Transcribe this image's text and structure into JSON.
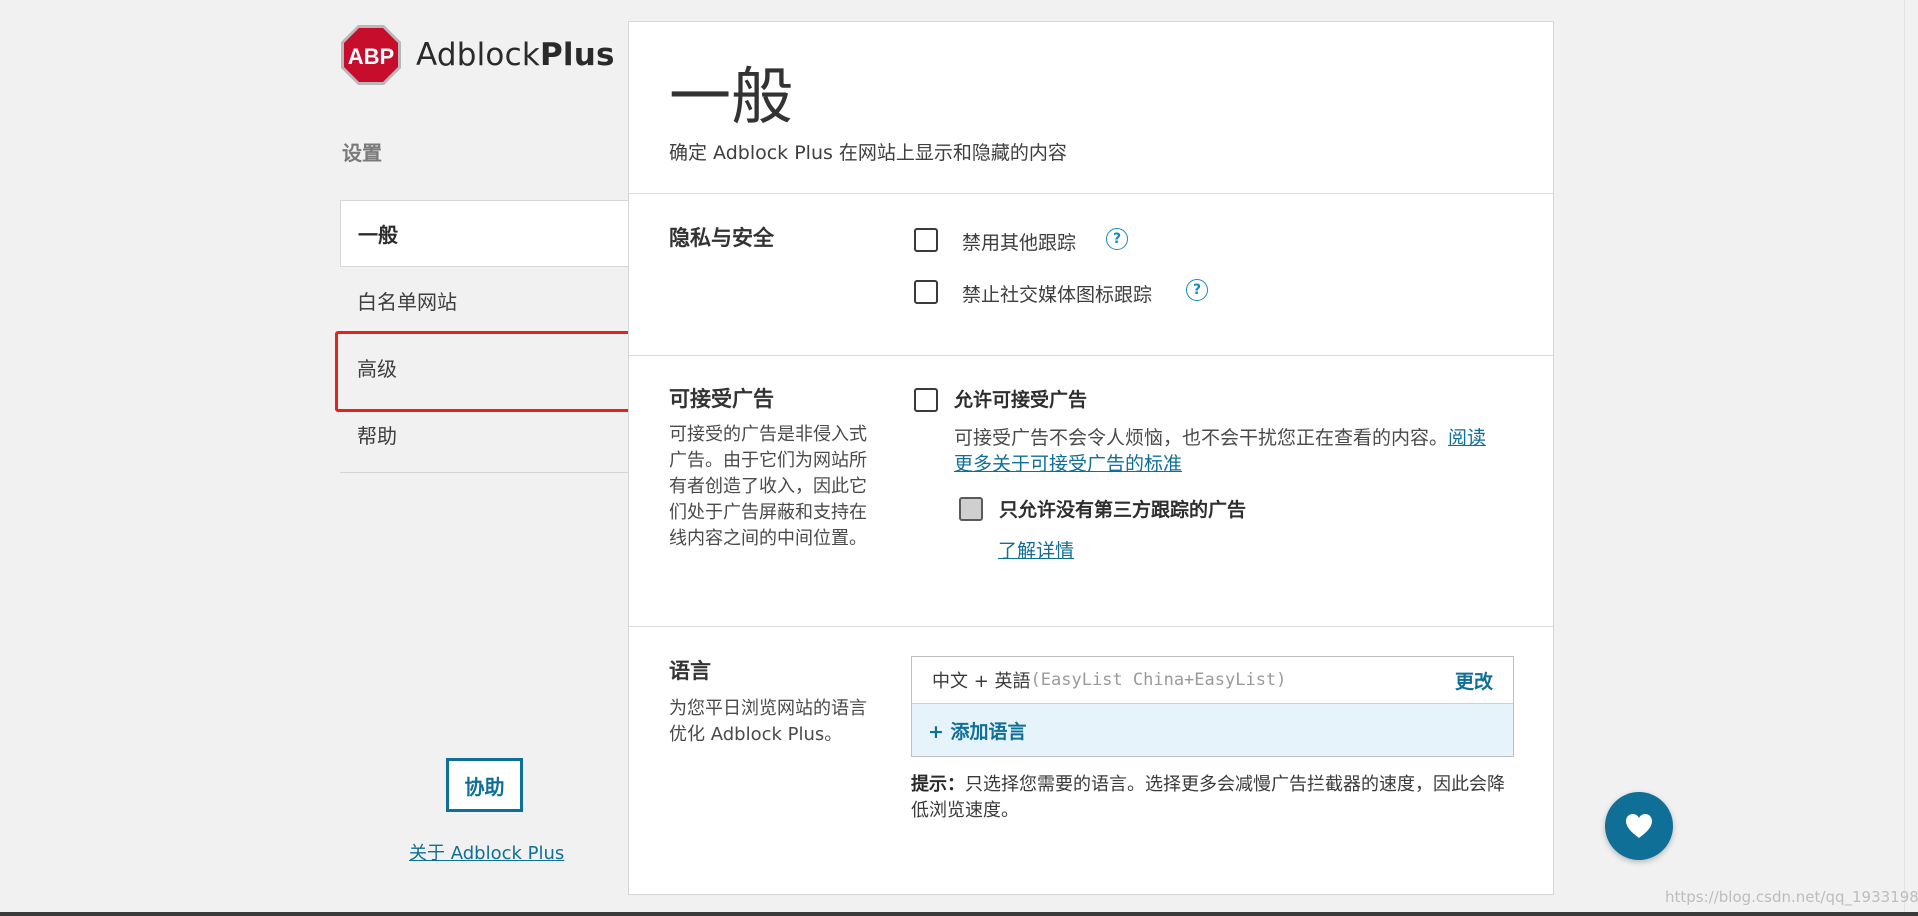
{
  "logo": {
    "mark_text": "ABP",
    "name_regular": "Adblock",
    "name_bold": "Plus"
  },
  "sidebar": {
    "section_label": "设置",
    "items": [
      {
        "label": "一般",
        "active": true
      },
      {
        "label": "白名单网站",
        "active": false
      },
      {
        "label": "高级",
        "active": false
      },
      {
        "label": "帮助",
        "active": false
      }
    ],
    "contribute_label": "协助",
    "about_link": "关于 Adblock Plus"
  },
  "main": {
    "title": "一般",
    "subtitle": "确定 Adblock Plus 在网站上显示和隐藏的内容",
    "privacy": {
      "title": "隐私与安全",
      "options": [
        {
          "label": "禁用其他跟踪",
          "checked": false
        },
        {
          "label": "禁止社交媒体图标跟踪",
          "checked": false
        }
      ]
    },
    "acceptable_ads": {
      "title": "可接受广告",
      "description": "可接受的广告是非侵入式广告。由于它们为网站所有者创造了收入，因此它们处于广告屏蔽和支持在线内容之间的中间位置。",
      "allow_label": "允许可接受广告",
      "allow_text": "可接受广告不会令人烦恼，也不会干扰您正在查看的内容。",
      "read_more_link": "阅读更多关于可接受广告的标准",
      "no_tracking_label": "只允许没有第三方跟踪的广告",
      "learn_more_link": "了解详情"
    },
    "language": {
      "title": "语言",
      "description": "为您平日浏览网站的语言优化 Adblock Plus。",
      "current_language": "中文 + 英語",
      "current_lists": "(EasyList China+EasyList)",
      "change_label": "更改",
      "add_label": "+ 添加语言",
      "tip_label": "提示：",
      "tip_text": "只选择您需要的语言。选择更多会减慢广告拦截器的速度，因此会降低浏览速度。"
    }
  },
  "favorite_icon": "heart-icon",
  "watermark": "https://blog.csdn.net/qq_1933198",
  "colors": {
    "accent": "#0f6f96",
    "highlight": "#e1231b",
    "logo_red": "#c70d2c"
  }
}
